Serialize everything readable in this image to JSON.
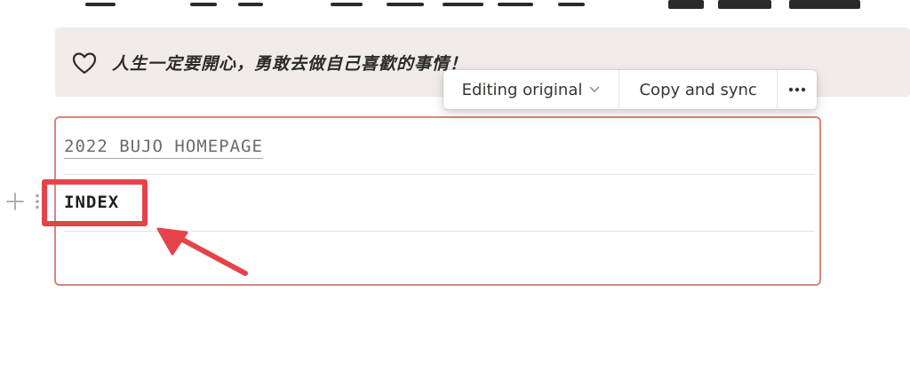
{
  "callout": {
    "icon": "heart-outline-icon",
    "text": "人生一定要開心，勇敢去做自己喜歡的事情！"
  },
  "sync_toolbar": {
    "editing_label": "Editing original",
    "copy_label": "Copy and sync",
    "more_icon": "more-horizontal-icon"
  },
  "synced_block": {
    "rows": [
      {
        "text": "2022 BUJO HOMEPAGE",
        "type": "link"
      },
      {
        "text": "INDEX",
        "type": "bold"
      },
      {
        "text": "",
        "type": "empty"
      }
    ]
  },
  "colors": {
    "callout_bg": "#f1ecea",
    "synced_border": "#d5877c",
    "annotation_red": "#e5434a"
  }
}
